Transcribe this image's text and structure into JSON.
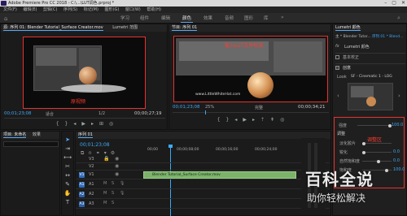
{
  "window": {
    "title": "Adobe Premiere Pro CC 2018 - C:\\...\\LUT调色.prproj *",
    "controls": [
      "–",
      "▢",
      "✕"
    ]
  },
  "menu": [
    "文件(F)",
    "编辑(E)",
    "剪辑(C)",
    "序列(S)",
    "标记(M)",
    "图形(G)",
    "窗口(W)",
    "帮助(H)"
  ],
  "workspaces": [
    "学习",
    "组件",
    "编辑",
    "颜色",
    "效果",
    "音频",
    "图形",
    "库"
  ],
  "workspace_active": "颜色",
  "source": {
    "tabs": [
      "源: 序列 01: Blender Tutorial_Surface Creator.mov",
      "Lumetri 范围"
    ],
    "annotation": "原视频",
    "timecode": "00;01;23;08",
    "fit": "适合",
    "scale": "1/2",
    "duration": "00;00;27;19"
  },
  "program": {
    "tab": "节目: 序列 01",
    "annotation": "载入LUT文件检测",
    "timecode": "00;01;23;08",
    "zoom": "25%",
    "quality": "完整",
    "duration": "00;00;34;21",
    "watermark": "www.LittleWhiteHat.com"
  },
  "lumetri": {
    "tab": "Lumetri 颜色",
    "clip_left": "主 * Blender Tutor...",
    "clip_right": "序列 01 * Blend...",
    "fx": "fx",
    "label_lumetri": "Lumetri 颜色",
    "basic": "基本校正",
    "creative": "创意",
    "look_label": "Look",
    "look_value": "SF - Cinematic 1 - LOG",
    "adjust_label": "强度",
    "adjust_value": "100.0",
    "sect_adjust": "调整",
    "params": [
      {
        "label": "淡化胶片",
        "value": "0.0"
      },
      {
        "label": "锐化",
        "value": "0.0"
      },
      {
        "label": "自然饱和度",
        "value": "0.0"
      },
      {
        "label": "饱和度",
        "value": "100.0"
      }
    ],
    "annotation": "调整区"
  },
  "project": {
    "tabs": [
      "项目: 未命名",
      "效果"
    ]
  },
  "timeline": {
    "tab": "序列 01",
    "timecode": "00;01;23;08",
    "ruler": [
      "00;00",
      "00;00;08;00",
      "00;00;16;00",
      "00;00;24;00",
      "00;00;"
    ],
    "video_tracks": [
      "V3",
      "V2",
      "V1"
    ],
    "audio_tracks": [
      "A1",
      "A2",
      "A3"
    ],
    "clip_name": "Blender Tutorial_Surface Creator.mov"
  },
  "watermark": {
    "text": "百科全说",
    "sub": "助你轻松解决"
  }
}
